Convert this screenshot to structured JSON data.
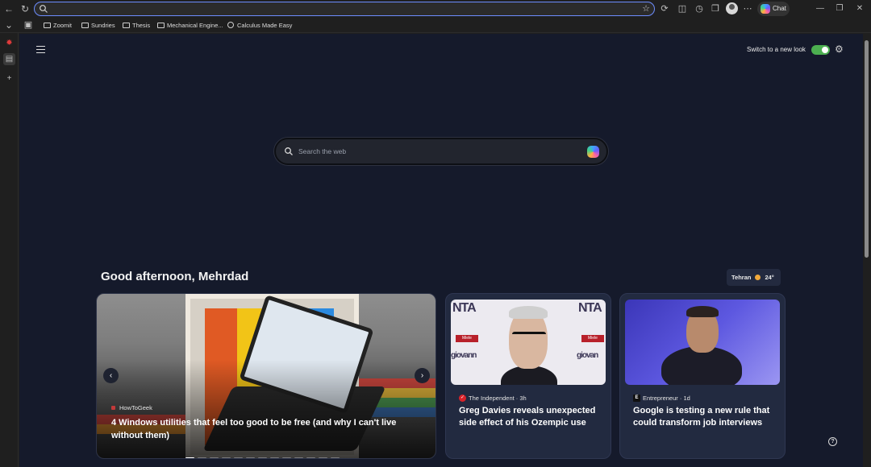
{
  "browser": {
    "address_value": "",
    "chat_label": "Chat",
    "favorites": [
      {
        "label": "Zoomit"
      },
      {
        "label": "Sundries"
      },
      {
        "label": "Thesis"
      },
      {
        "label": "Mechanical Engine..."
      },
      {
        "label": "Calculus Made Easy"
      }
    ]
  },
  "page": {
    "switch_label": "Switch to a new look",
    "search_placeholder": "Search the web",
    "greeting": "Good afternoon, Mehrdad",
    "weather": {
      "city": "Tehran",
      "temp": "24°"
    },
    "hero": {
      "source": "HowToGeek",
      "title": "4 Windows utilities that feel too good to be free (and why I can't live without them)",
      "slides_total": 13,
      "active_slide": 1
    },
    "cards": [
      {
        "source": "The Independent · 3h",
        "title": "Greg Davies reveals unexpected side effect of his Ozempic use"
      },
      {
        "source": "Entrepreneur · 1d",
        "title": "Google is testing a new rule that could transform job interviews"
      }
    ]
  },
  "colors": {
    "page_bg": "#151a2b",
    "accent_address": "#6d8dff",
    "toggle_on": "#4caf50",
    "card_bg": "#222a40"
  }
}
